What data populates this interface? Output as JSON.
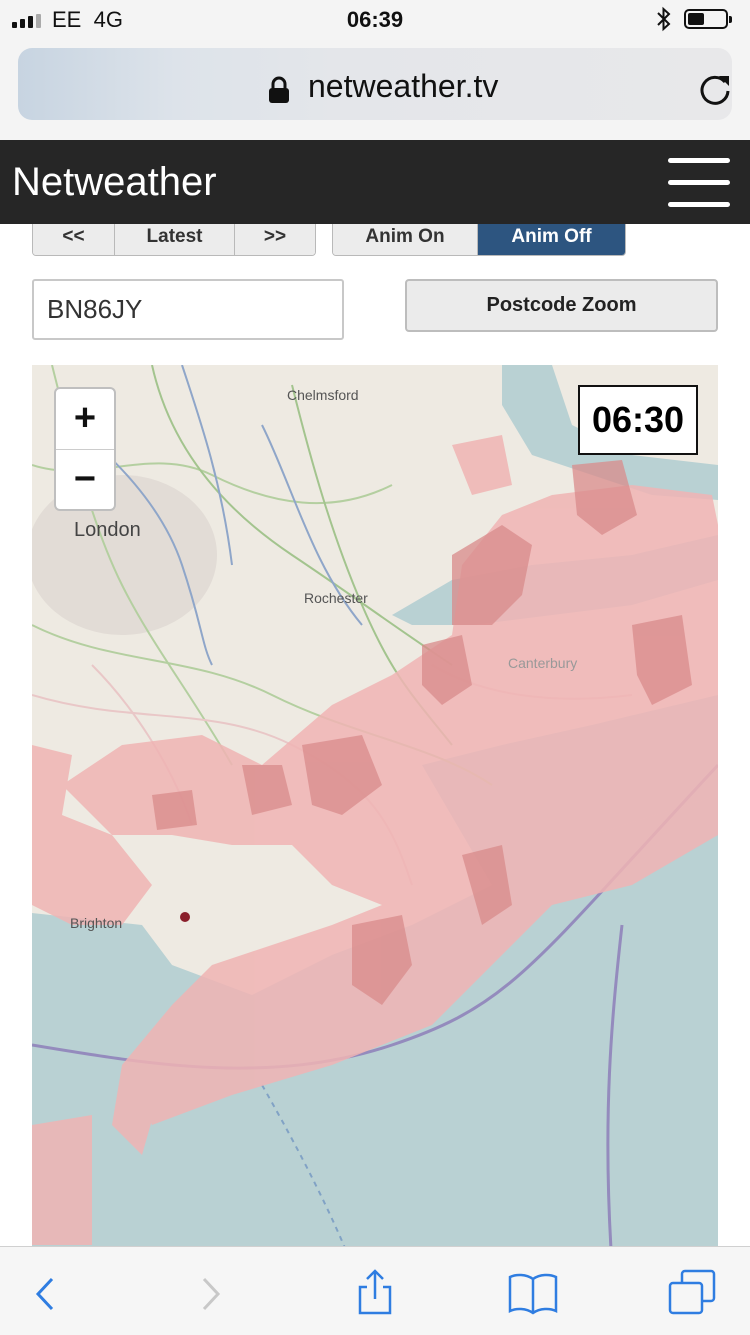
{
  "status_bar": {
    "carrier": "EE",
    "network": "4G",
    "time": "06:39"
  },
  "browser": {
    "url": "netweather.tv"
  },
  "site": {
    "brand": "Netweather"
  },
  "controls": {
    "prev_label": "<<",
    "latest_label": "Latest",
    "next_label": ">>",
    "anim_on_label": "Anim On",
    "anim_off_label": "Anim Off",
    "postcode_value": "BN86JY",
    "postcode_zoom_label": "Postcode Zoom"
  },
  "map": {
    "zoom_in": "+",
    "zoom_out": "−",
    "timestamp": "06:30",
    "places": {
      "chelmsford": "Chelmsford",
      "london": "London",
      "rochester": "Rochester",
      "canterbury": "Canterbury",
      "brighton": "Brighton"
    }
  },
  "colors": {
    "header": "#262626",
    "anim_active": "#2d5580",
    "sea": "#b9d1d3",
    "rain_light": "#f0b4b4",
    "rain_heavy": "#d98b8b"
  }
}
